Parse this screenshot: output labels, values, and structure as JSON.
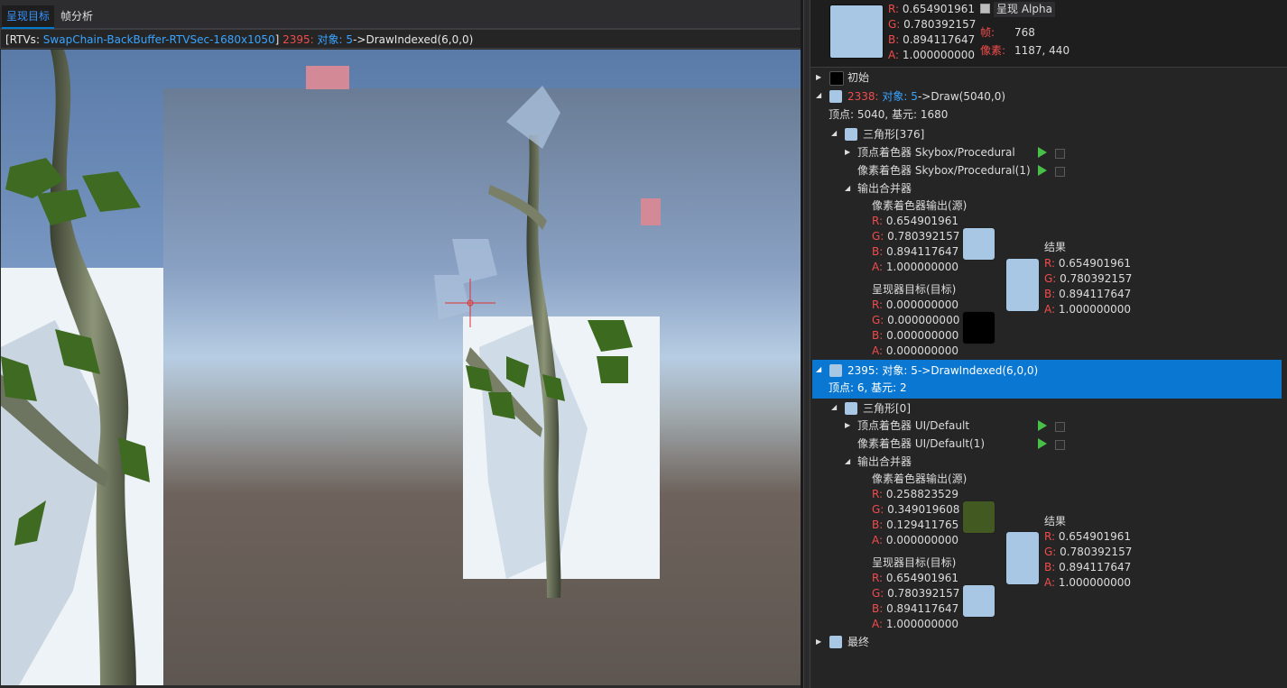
{
  "tabs": [
    {
      "label": "呈现目标"
    },
    {
      "label": "帧分析"
    }
  ],
  "pathbar": {
    "prefix": "[RTVs: ",
    "rtv": "SwapChain-BackBuffer-RTVSec-1680x1050",
    "suffix": "]",
    "event_num": "2395:",
    "object_label": "对象:",
    "object_num": "5",
    "call": "->DrawIndexed(6,0,0)"
  },
  "pixel_header": {
    "color_hex": "#a7c7e4",
    "r_label": "R:",
    "r": "0.654901961",
    "g_label": "G:",
    "g": "0.780392157",
    "b_label": "B:",
    "b": "0.894117647",
    "a_label": "A:",
    "a": "1.000000000",
    "alpha_label": "呈现 Alpha",
    "frame_label": "帧:",
    "frame": "768",
    "pixel_label": "像素:",
    "pixel": "1187, 440"
  },
  "history": {
    "initial_label": "初始",
    "final_label": "最终",
    "events": [
      {
        "id": "2338:",
        "object": "对象:",
        "object_num": "5",
        "call": "->Draw(5040,0)",
        "info": "顶点: 5040, 基元: 1680",
        "triangle": "三角形[376]",
        "vs_label": "顶点着色器",
        "vs": "Skybox/Procedural",
        "ps_label": "像素着色器",
        "ps": "Skybox/Procedural(1)",
        "om_label": "输出合并器",
        "src_label": "像素着色器输出(源)",
        "src": {
          "r": "0.654901961",
          "g": "0.780392157",
          "b": "0.894117647",
          "a": "1.000000000",
          "color": "#a7c7e4"
        },
        "dst_label": "呈现器目标(目标)",
        "dst": {
          "r": "0.000000000",
          "g": "0.000000000",
          "b": "0.000000000",
          "a": "0.000000000",
          "color": "#000000"
        },
        "result_label": "结果",
        "result": {
          "r": "0.654901961",
          "g": "0.780392157",
          "b": "0.894117647",
          "a": "1.000000000",
          "color": "#a7c7e4"
        }
      },
      {
        "id": "2395:",
        "object": "对象:",
        "object_num": "5",
        "call": "->DrawIndexed(6,0,0)",
        "info": "顶点: 6, 基元: 2",
        "triangle": "三角形[0]",
        "vs_label": "顶点着色器",
        "vs": "UI/Default",
        "ps_label": "像素着色器",
        "ps": "UI/Default(1)",
        "om_label": "输出合并器",
        "src_label": "像素着色器输出(源)",
        "src": {
          "r": "0.258823529",
          "g": "0.349019608",
          "b": "0.129411765",
          "a": "0.000000000",
          "color": "#425921"
        },
        "dst_label": "呈现器目标(目标)",
        "dst": {
          "r": "0.654901961",
          "g": "0.780392157",
          "b": "0.894117647",
          "a": "1.000000000",
          "color": "#a7c7e4"
        },
        "result_label": "结果",
        "result": {
          "r": "0.654901961",
          "g": "0.780392157",
          "b": "0.894117647",
          "a": "1.000000000",
          "color": "#a7c7e4"
        }
      }
    ]
  },
  "channel_labels": {
    "r": "R:",
    "g": "G:",
    "b": "B:",
    "a": "A:"
  }
}
